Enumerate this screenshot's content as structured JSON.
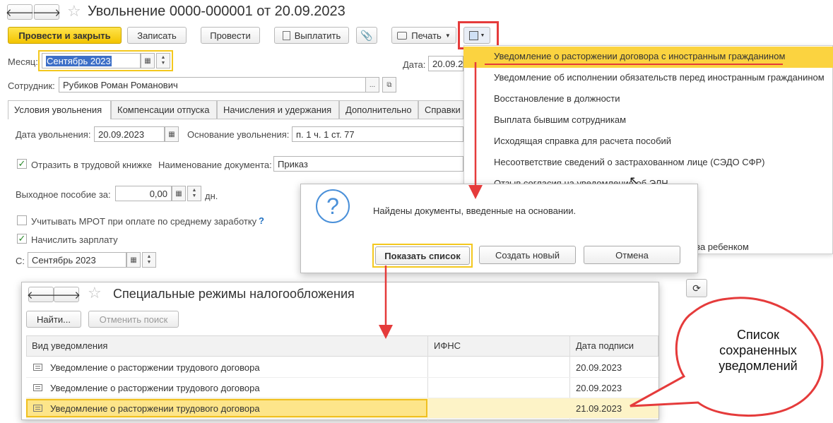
{
  "header": {
    "back_icon": "arrow-left-icon",
    "forward_icon": "arrow-right-icon",
    "star_icon": "star-icon",
    "title": "Увольнение 0000-000001 от 20.09.2023"
  },
  "toolbar": {
    "post_close": "Провести и закрыть",
    "save": "Записать",
    "post": "Провести",
    "pay": "Выплатить",
    "print": "Печать"
  },
  "form": {
    "month_label": "Месяц:",
    "month_value": "Сентябрь 2023",
    "date_label": "Дата:",
    "date_value": "20.09.2",
    "employee_label": "Сотрудник:",
    "employee_value": "Рубиков Роман Романович",
    "ellipsis": "..."
  },
  "tabs": [
    "Условия увольнения",
    "Компенсации отпуска",
    "Начисления и удержания",
    "Дополнительно",
    "Справки"
  ],
  "conditions": {
    "dismissal_date_label": "Дата увольнения:",
    "dismissal_date_value": "20.09.2023",
    "basis_label": "Основание увольнения:",
    "basis_value": "п. 1 ч. 1 ст. 77",
    "reflect_label": "Отразить в трудовой книжке",
    "docname_label": "Наименование документа:",
    "docname_value": "Приказ",
    "severance_label": "Выходное пособие за:",
    "severance_value": "0,00",
    "days_unit": "дн.",
    "mrot_label": "Учитывать МРОТ при оплате по среднему заработку",
    "help": "?",
    "salary_label": "Начислить зарплату",
    "from_label": "С:",
    "from_value": "Сентябрь 2023"
  },
  "menu": {
    "items": [
      "Уведомление о расторжении договора с иностранным гражданином",
      "Уведомление об исполнении обязательств перед иностранным гражданином",
      "Восстановление в должности",
      "Выплата бывшим сотрудникам",
      "Исходящая справка для расчета пособий",
      "Несоответствие сведений о застрахованном лице (СЭДО СФР)",
      "Отзыв согласия на уведомление об ЭЛН"
    ],
    "partial_item": "за ребенком"
  },
  "dialog": {
    "icon": "question-icon",
    "message": "Найдены документы, введенные на основании.",
    "show_list": "Показать список",
    "create_new": "Создать новый",
    "cancel": "Отмена"
  },
  "list_window": {
    "title": "Специальные режимы налогообложения",
    "find": "Найти...",
    "cancel_search": "Отменить поиск",
    "columns": [
      "Вид уведомления",
      "ИФНС",
      "Дата подписи"
    ],
    "rows": [
      {
        "type": "Уведомление о расторжении трудового договора",
        "ifns": "",
        "date": "20.09.2023"
      },
      {
        "type": "Уведомление о расторжении трудового договора",
        "ifns": "",
        "date": "20.09.2023"
      },
      {
        "type": "Уведомление о расторжении трудового договора",
        "ifns": "",
        "date": "21.09.2023"
      }
    ]
  },
  "callout": {
    "text": "Список сохраненных уведомлений"
  },
  "colors": {
    "accent_yellow": "#f7d230",
    "annotation_red": "#e53b3b",
    "menu_highlight": "#fbd340"
  }
}
